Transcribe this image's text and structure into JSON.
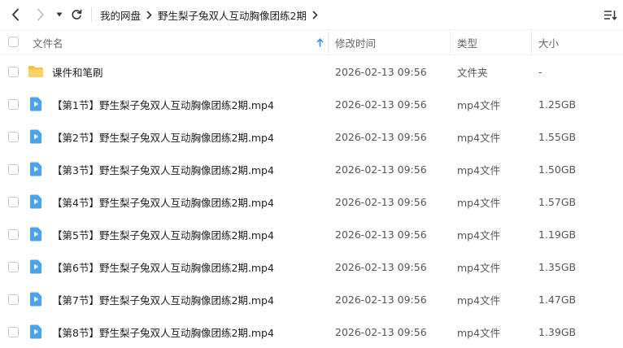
{
  "toolbar": {
    "back_icon": "chevron-left-icon",
    "forward_icon": "chevron-right-icon",
    "dropdown_icon": "caret-down-icon",
    "refresh_icon": "refresh-icon",
    "view_icon": "list-sort-icon",
    "breadcrumb": [
      "我的网盘",
      "野生梨子兔双人互动胸像团练2期"
    ]
  },
  "header": {
    "name": "文件名",
    "modified": "修改时间",
    "type": "类型",
    "size": "大小",
    "sort_icon": "sort-up-arrow-icon"
  },
  "colors": {
    "accent": "#3b8cf5",
    "folder": "#f7c245",
    "video": "#4aa3ef"
  },
  "rows": [
    {
      "icon": "folder-icon",
      "name": "课件和笔刷",
      "modified": "2026-02-13 09:56",
      "type": "文件夹",
      "size": "-"
    },
    {
      "icon": "video-file-icon",
      "name": "【第1节】野生梨子兔双人互动胸像团练2期.mp4",
      "modified": "2026-02-13 09:56",
      "type": "mp4文件",
      "size": "1.25GB"
    },
    {
      "icon": "video-file-icon",
      "name": "【第2节】野生梨子兔双人互动胸像团练2期.mp4",
      "modified": "2026-02-13 09:56",
      "type": "mp4文件",
      "size": "1.55GB"
    },
    {
      "icon": "video-file-icon",
      "name": "【第3节】野生梨子兔双人互动胸像团练2期.mp4",
      "modified": "2026-02-13 09:56",
      "type": "mp4文件",
      "size": "1.50GB"
    },
    {
      "icon": "video-file-icon",
      "name": "【第4节】野生梨子兔双人互动胸像团练2期.mp4",
      "modified": "2026-02-13 09:56",
      "type": "mp4文件",
      "size": "1.57GB"
    },
    {
      "icon": "video-file-icon",
      "name": "【第5节】野生梨子兔双人互动胸像团练2期.mp4",
      "modified": "2026-02-13 09:56",
      "type": "mp4文件",
      "size": "1.19GB"
    },
    {
      "icon": "video-file-icon",
      "name": "【第6节】野生梨子兔双人互动胸像团练2期.mp4",
      "modified": "2026-02-13 09:56",
      "type": "mp4文件",
      "size": "1.35GB"
    },
    {
      "icon": "video-file-icon",
      "name": "【第7节】野生梨子兔双人互动胸像团练2期.mp4",
      "modified": "2026-02-13 09:56",
      "type": "mp4文件",
      "size": "1.47GB"
    },
    {
      "icon": "video-file-icon",
      "name": "【第8节】野生梨子兔双人互动胸像团练2期.mp4",
      "modified": "2026-02-13 09:56",
      "type": "mp4文件",
      "size": "1.39GB"
    }
  ]
}
